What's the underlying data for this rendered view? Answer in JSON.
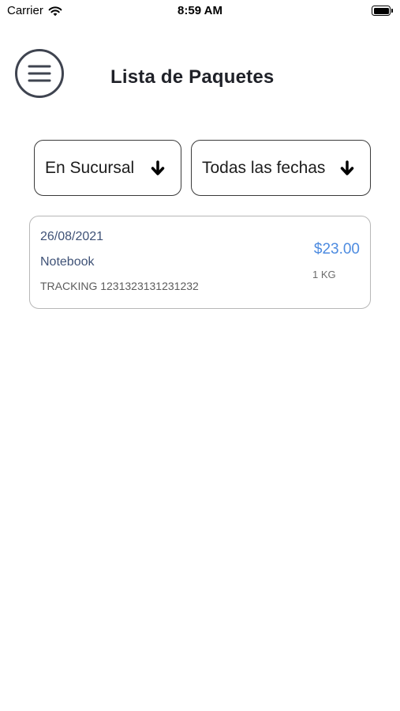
{
  "status_bar": {
    "carrier": "Carrier",
    "time": "8:59 AM"
  },
  "header": {
    "title": "Lista de Paquetes",
    "menu_icon": "hamburger-menu-icon"
  },
  "filters": [
    {
      "label": "En Sucursal",
      "icon": "arrow-down-icon"
    },
    {
      "label": "Todas las fechas",
      "icon": "arrow-down-icon"
    }
  ],
  "packages": [
    {
      "date": "26/08/2021",
      "name": "Notebook",
      "tracking": "TRACKING 1231323131231232",
      "price": "$23.00",
      "weight": "1 KG"
    }
  ],
  "colors": {
    "accent": "#4d8be0",
    "text_dark": "#1f2128",
    "item_text": "#3f5277"
  }
}
